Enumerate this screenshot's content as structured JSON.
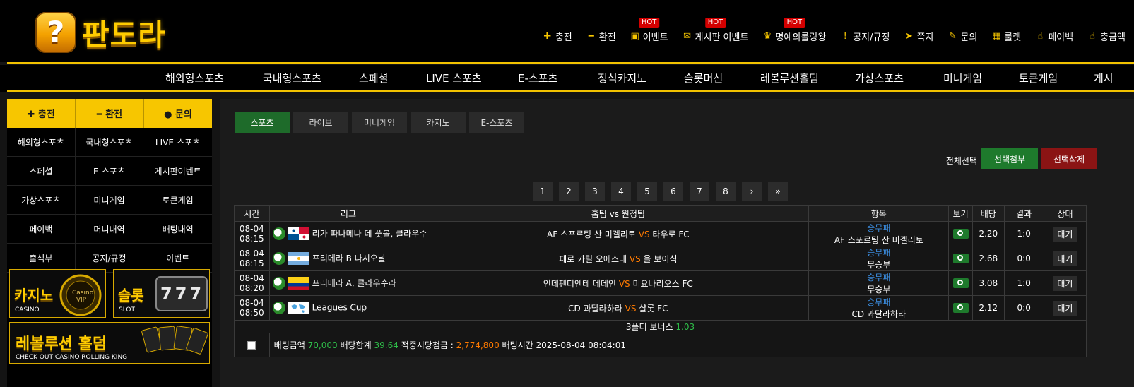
{
  "brand": {
    "logo_glyph": "?",
    "name": "판도라"
  },
  "topnav": [
    {
      "label": "충전",
      "icon": "plus-icon",
      "glyph": "✚",
      "hot": ""
    },
    {
      "label": "환전",
      "icon": "minus-icon",
      "glyph": "━",
      "hot": ""
    },
    {
      "label": "이벤트",
      "icon": "calendar-icon",
      "glyph": "▣",
      "hot": "HOT"
    },
    {
      "label": "게시판 이벤트",
      "icon": "mail-icon",
      "glyph": "✉",
      "hot": "HOT"
    },
    {
      "label": "명예의롤링왕",
      "icon": "trophy-icon",
      "glyph": "♛",
      "hot": "HOT"
    },
    {
      "label": "공지/규정",
      "icon": "info-icon",
      "glyph": "!",
      "hot": ""
    },
    {
      "label": "쪽지",
      "icon": "send-icon",
      "glyph": "➤",
      "hot": ""
    },
    {
      "label": "문의",
      "icon": "edit-icon",
      "glyph": "✎",
      "hot": ""
    },
    {
      "label": "룰렛",
      "icon": "roulette-icon",
      "glyph": "▦",
      "hot": ""
    },
    {
      "label": "페이백",
      "icon": "payback-icon",
      "glyph": "☝",
      "hot": ""
    },
    {
      "label": "충금액",
      "icon": "amount-icon",
      "glyph": "☝",
      "hot": ""
    }
  ],
  "mainnav": [
    "해외형스포츠",
    "국내형스포츠",
    "스페셜",
    "LIVE 스포츠",
    "E-스포츠",
    "정식카지노",
    "슬롯머신",
    "레볼루션홀덤",
    "가상스포츠",
    "미니게임",
    "토큰게임",
    "게시"
  ],
  "sidebar": {
    "top": [
      {
        "label": "✚ 충전"
      },
      {
        "label": "━ 환전"
      },
      {
        "label": "● 문의"
      }
    ],
    "grid": [
      "해외형스포츠",
      "국내형스포츠",
      "LIVE-스포츠",
      "스페셜",
      "E-스포츠",
      "게시판이벤트",
      "가상스포츠",
      "미니게임",
      "토큰게임",
      "페이백",
      "머니내역",
      "배팅내역",
      "출석부",
      "공지/규정",
      "이벤트"
    ],
    "banners": {
      "casino_title": "카지노",
      "casino_sub": "CASINO",
      "casino_badge": "Casino VIP",
      "slot_title": "슬롯",
      "slot_sub": "SLOT",
      "slot_reels": "777",
      "holdem_title": "레볼루션 홀덤",
      "holdem_sub": "CHECK OUT CASINO ROLLING KING"
    }
  },
  "tabs": [
    "스포츠",
    "라이브",
    "미니게임",
    "카지노",
    "E-스포츠"
  ],
  "actions": {
    "select_all": "전체선택",
    "attach": "선택첨부",
    "delete": "선택삭제"
  },
  "pager": [
    "1",
    "2",
    "3",
    "4",
    "5",
    "6",
    "7",
    "8",
    "›",
    "»"
  ],
  "table": {
    "headers": [
      "시간",
      "리그",
      "홈팀 vs 원정팀",
      "항목",
      "보기",
      "배당",
      "결과",
      "상태"
    ],
    "rows": [
      {
        "date": "08-04",
        "time": "08:15",
        "flag": "panama",
        "league": "리가 파나메나 데 풋볼, 클라우수",
        "home": "AF 스포르팅 산 미겔리토",
        "vs": "VS",
        "away": "타우로 FC",
        "market": "승무패",
        "pick": "AF 스포르팅 산 미겔리토",
        "odds": "2.20",
        "result": "1:0",
        "status": "대기"
      },
      {
        "date": "08-04",
        "time": "08:15",
        "flag": "argentina",
        "league": "프리메라 B 나시오날",
        "home": "페로 카릴 오에스테",
        "vs": "VS",
        "away": "올 보이식",
        "market": "승무패",
        "pick": "무승부",
        "odds": "2.68",
        "result": "0:0",
        "status": "대기"
      },
      {
        "date": "08-04",
        "time": "08:20",
        "flag": "colombia",
        "league": "프리메라 A, 클라우수라",
        "home": "인데펜디엔테 메데인",
        "vs": "VS",
        "away": "미요나리오스 FC",
        "market": "승무패",
        "pick": "무승부",
        "odds": "3.08",
        "result": "1:0",
        "status": "대기"
      },
      {
        "date": "08-04",
        "time": "08:50",
        "flag": "world",
        "league": "Leagues Cup",
        "home": "CD 과달라하라",
        "vs": "VS",
        "away": "샬롯 FC",
        "market": "승무패",
        "pick": "CD 과달라하라",
        "odds": "2.12",
        "result": "0:0",
        "status": "대기"
      }
    ],
    "bonus_label": "3폴더 보너스",
    "bonus_value": "1.03",
    "summary": {
      "amount_label": "배팅금액",
      "amount": "70,000",
      "total_label": "배당합계",
      "total": "39.64",
      "win_label": "적중시당첨금 :",
      "win": "2,774,800",
      "time_label": "배팅시간",
      "time": "2025-08-04 08:04:01"
    }
  }
}
